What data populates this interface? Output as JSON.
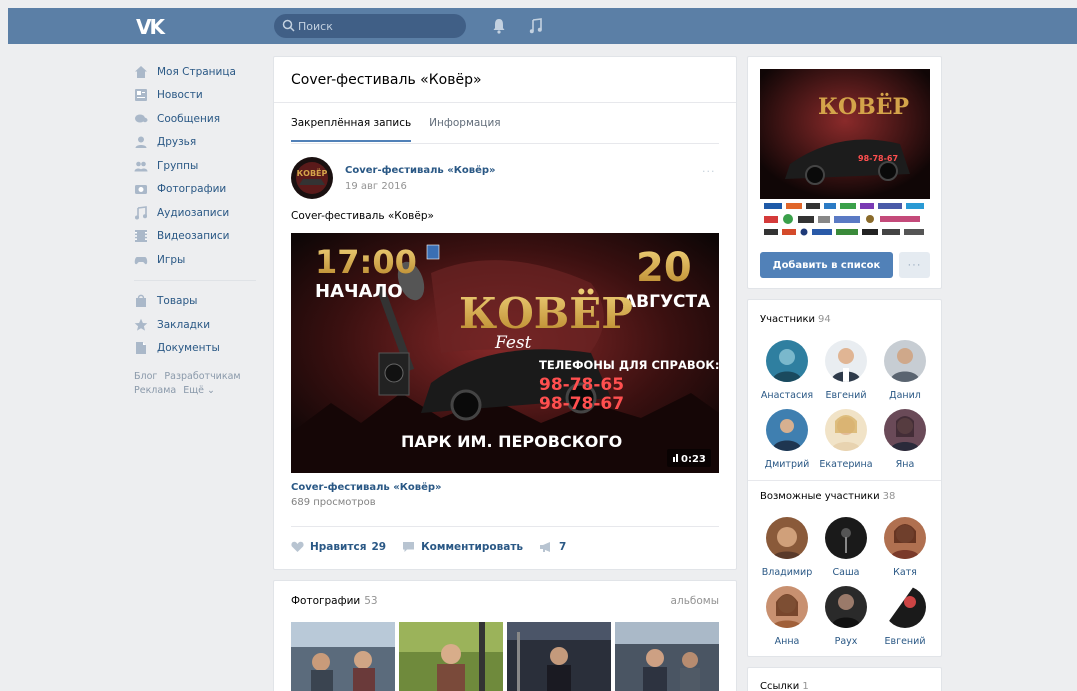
{
  "topbar": {
    "logo": "VK",
    "search_placeholder": "Поиск"
  },
  "nav": {
    "items": [
      {
        "label": "Моя Страница",
        "icon": "home-icon"
      },
      {
        "label": "Новости",
        "icon": "news-icon"
      },
      {
        "label": "Сообщения",
        "icon": "messages-icon"
      },
      {
        "label": "Друзья",
        "icon": "friends-icon"
      },
      {
        "label": "Группы",
        "icon": "groups-icon"
      },
      {
        "label": "Фотографии",
        "icon": "camera-icon"
      },
      {
        "label": "Аудиозаписи",
        "icon": "music-note-icon"
      },
      {
        "label": "Видеозаписи",
        "icon": "video-icon"
      },
      {
        "label": "Игры",
        "icon": "gamepad-icon"
      },
      {
        "label": "Товары",
        "icon": "bag-icon"
      },
      {
        "label": "Закладки",
        "icon": "star-icon"
      },
      {
        "label": "Документы",
        "icon": "document-icon"
      }
    ],
    "footer": [
      "Блог",
      "Разработчикам",
      "Реклама",
      "Ещё ⌄"
    ]
  },
  "group": {
    "title": "Cover-фестиваль «Ковёр»",
    "tabs": [
      "Закреплённая запись",
      "Информация"
    ],
    "post": {
      "author": "Cover-фестиваль «Ковёр»",
      "date": "19 авг 2016",
      "more": "···",
      "text": "Cover-фестиваль «Ковёр»",
      "video": {
        "time_label": "17:00",
        "start_label": "НАЧАЛО",
        "day": "20",
        "month": "АВГУСТА",
        "brand": "КОВЁР",
        "brand_sub": "Fest",
        "phones_label": "ТЕЛЕФОНЫ ДЛЯ СПРАВОК:",
        "phone1": "98-78-65",
        "phone2": "98-78-67",
        "place": "ПАРК ИМ. ПЕРОВСКОГО",
        "duration": "0:23"
      },
      "video_title": "Cover-фестиваль «Ковёр»",
      "views": "689 просмотров",
      "likes_label": "Нравится",
      "likes_count": "29",
      "comment_label": "Комментировать",
      "shares_count": "7"
    }
  },
  "photos": {
    "title": "Фотографии",
    "count": "53",
    "albums_label": "альбомы"
  },
  "cover": {
    "brand": "КОВЁР",
    "phones": "98-78-67",
    "add_button": "Добавить в список",
    "more_button": "···"
  },
  "members": {
    "title": "Участники",
    "count": "94",
    "people": [
      "Анастасия",
      "Евгений",
      "Данил",
      "Дмитрий",
      "Екатерина",
      "Яна"
    ]
  },
  "possible": {
    "title": "Возможные участники",
    "count": "38",
    "people": [
      "Владимир",
      "Саша",
      "Катя",
      "Анна",
      "Раух",
      "Евгений"
    ]
  },
  "links": {
    "title": "Ссылки",
    "count": "1"
  },
  "colors": {
    "header": "#5b7fa6",
    "link": "#2a5885",
    "button": "#5181b8",
    "background": "#edeef0"
  }
}
